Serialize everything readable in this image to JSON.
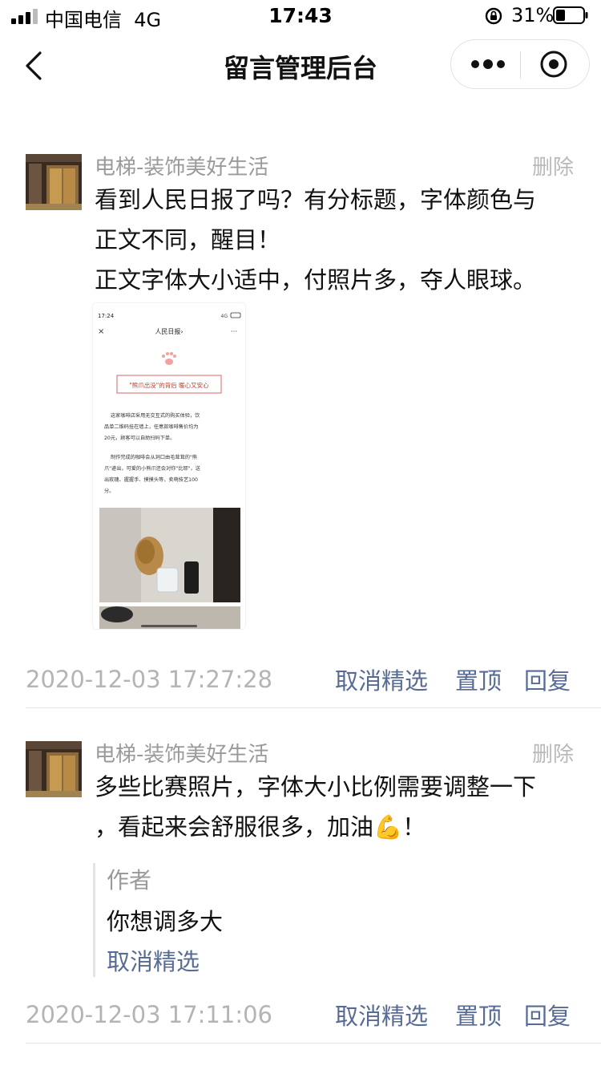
{
  "status": {
    "carrier": "中国电信",
    "network": "4G",
    "time": "17:43",
    "battery": "31%"
  },
  "nav": {
    "title": "留言管理后台"
  },
  "comments": [
    {
      "author": "电梯-装饰美好生活",
      "delete_label": "删除",
      "lines": [
        "看到人民日报了吗？有分标题，字体颜色与",
        "正文不同，醒目！",
        "正文字体大小适中，付照片多，夺人眼球。"
      ],
      "attachment": {
        "status_time": "17:24",
        "status_net": "4G",
        "title": "人民日报",
        "headline": "\"熊爪出没\"的背后 暖心又安心",
        "para1": [
          "这家咖啡店采用无交互式的购买体验，饮",
          "品单二维码挂在墙上，任意款咖啡售价均为",
          "20元，顾客可以自助扫码下单。"
        ],
        "para2": [
          "制作完成的咖啡会从洞口由毛茸茸的\"熊",
          "爪\"递出，可爱的小熊爪还会对你\"比耶\"，送",
          "出玫瑰、握握手、摸摸头等，卖萌技艺100",
          "分。"
        ]
      },
      "timestamp": "2020-12-03 17:27:28",
      "actions": {
        "unfeature": "取消精选",
        "pin": "置顶",
        "reply": "回复"
      }
    },
    {
      "author": "电梯-装饰美好生活",
      "delete_label": "删除",
      "lines": [
        "多些比赛照片，字体大小比例需要调整一下",
        "，看起来会舒服很多，加油💪！"
      ],
      "reply": {
        "label": "作者",
        "text": "你想调多大",
        "unfeature": "取消精选"
      },
      "timestamp": "2020-12-03 17:11:06",
      "actions": {
        "unfeature": "取消精选",
        "pin": "置顶",
        "reply": "回复"
      }
    }
  ]
}
